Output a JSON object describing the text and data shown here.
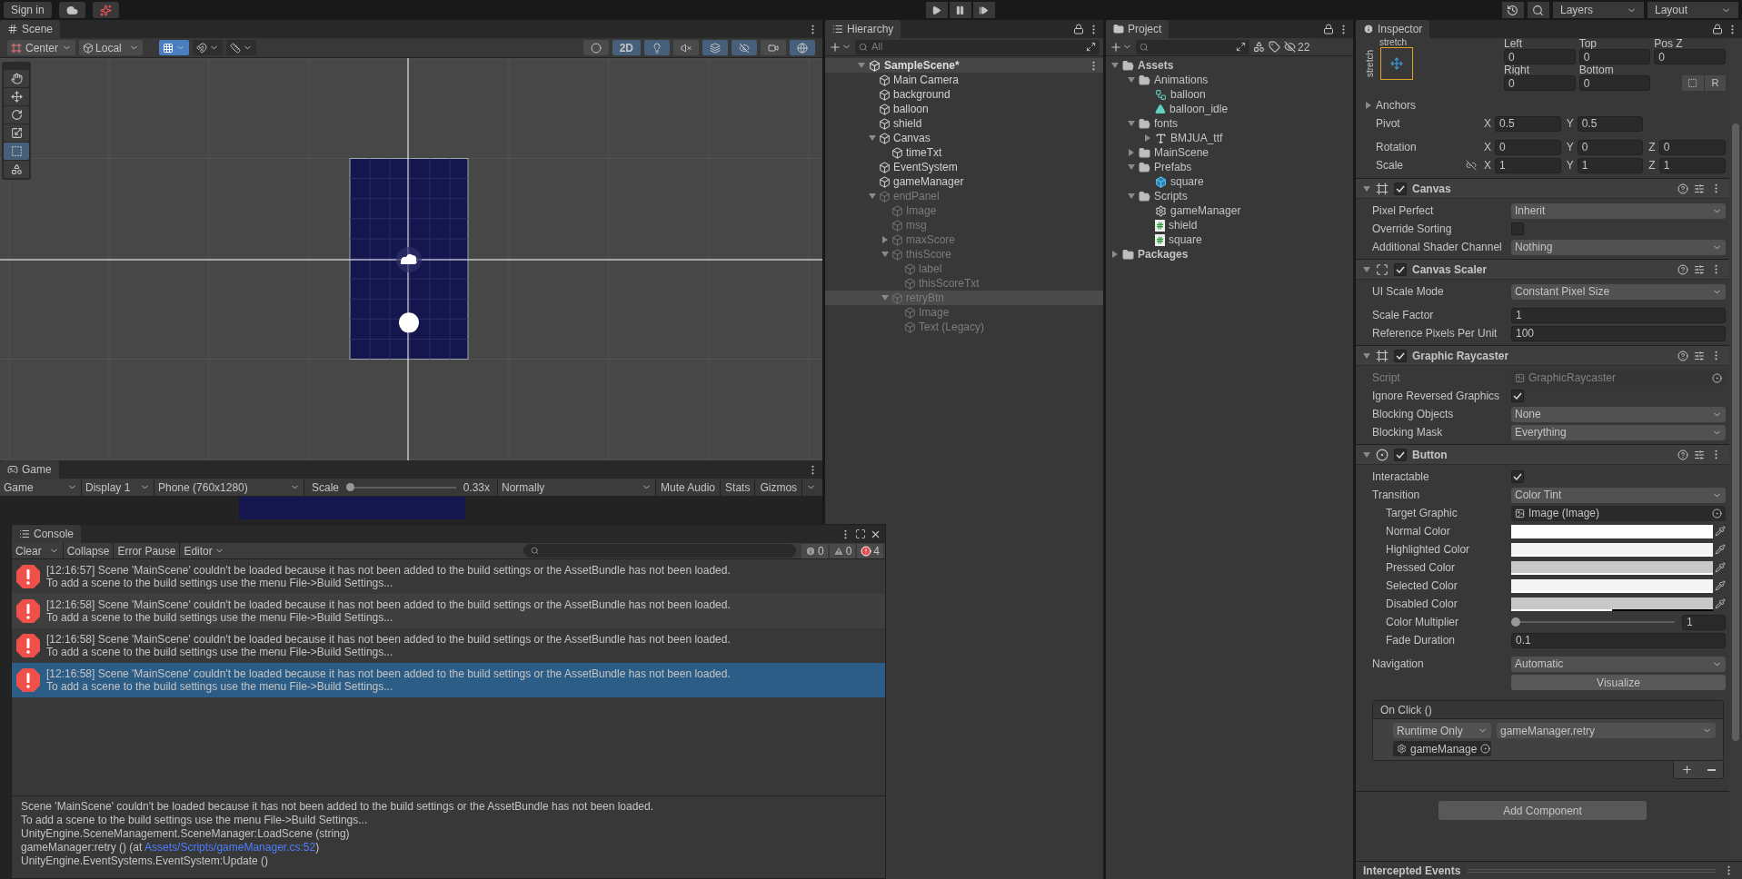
{
  "toolbar": {
    "sign_in": "Sign in",
    "layers": "Layers",
    "layout": "Layout"
  },
  "scene": {
    "tab": "Scene",
    "pivot": "Center",
    "space": "Local",
    "snap_toggles": [
      {
        "kind": "grid",
        "on": true
      },
      {
        "kind": "increment",
        "on": false
      },
      {
        "kind": "ruler",
        "on": false
      }
    ],
    "view_toggles": [
      {
        "kind": "shading",
        "on": false
      },
      {
        "kind": "dimension",
        "label": "2D",
        "on": true
      },
      {
        "kind": "light",
        "on": true
      },
      {
        "kind": "audio",
        "on": false
      },
      {
        "kind": "effects",
        "on": true
      },
      {
        "kind": "hidden",
        "on": true
      },
      {
        "kind": "camera",
        "on": false
      },
      {
        "kind": "gizmos",
        "on": true
      }
    ],
    "tools": [
      {
        "kind": "hand",
        "selected": false
      },
      {
        "kind": "move",
        "selected": false
      },
      {
        "kind": "rotate",
        "selected": false
      },
      {
        "kind": "scale",
        "selected": false
      },
      {
        "kind": "rect",
        "selected": true
      },
      {
        "kind": "transform",
        "selected": false
      }
    ]
  },
  "game": {
    "tab": "Game",
    "view": "Game",
    "display": "Display 1",
    "resolution": "Phone (760x1280)",
    "scale_label": "Scale",
    "scale": {
      "level": 0,
      "reading": "0.33x"
    },
    "play_focus": "Normally",
    "buttons": [
      "Mute Audio",
      "Stats",
      "Gizmos"
    ]
  },
  "hierarchy": {
    "tab": "Hierarchy",
    "placeholder": "All",
    "scene": "SampleScene*",
    "items": [
      {
        "label": "Main Camera",
        "active": true,
        "selected": false
      },
      {
        "label": "background",
        "active": true,
        "selected": false
      },
      {
        "label": "balloon",
        "active": true,
        "selected": false
      },
      {
        "label": "shield",
        "active": true,
        "selected": false
      },
      {
        "label": "Canvas",
        "active": true,
        "selected": false,
        "expanded": true,
        "children": [
          {
            "label": "timeTxt",
            "active": true,
            "selected": false
          }
        ]
      },
      {
        "label": "EventSystem",
        "active": true,
        "selected": false
      },
      {
        "label": "gameManager",
        "active": true,
        "selected": false
      },
      {
        "label": "endPanel",
        "active": false,
        "selected": false,
        "expanded": true,
        "children": [
          {
            "label": "Image",
            "active": false,
            "selected": false
          },
          {
            "label": "msg",
            "active": false,
            "selected": false
          },
          {
            "label": "maxScore",
            "active": false,
            "selected": false,
            "expanded": false
          },
          {
            "label": "thisScore",
            "active": false,
            "selected": false,
            "expanded": true,
            "children": [
              {
                "label": "label",
                "active": false,
                "selected": false
              },
              {
                "label": "thisScoreTxt",
                "active": false,
                "selected": false
              }
            ]
          },
          {
            "label": "retryBtn",
            "active": false,
            "selected": true,
            "expanded": true,
            "children": [
              {
                "label": "Image",
                "active": false,
                "selected": false
              },
              {
                "label": "Text (Legacy)",
                "active": false,
                "selected": false
              }
            ]
          }
        ]
      }
    ]
  },
  "project": {
    "tab": "Project",
    "hidden_count": "22",
    "items": [
      {
        "label": "Assets",
        "kind": "folder",
        "expanded": true,
        "bold": true,
        "children": [
          {
            "label": "Animations",
            "kind": "folder",
            "expanded": true,
            "children": [
              {
                "label": "balloon",
                "kind": "controller"
              },
              {
                "label": "balloon_idle",
                "kind": "clip"
              }
            ]
          },
          {
            "label": "fonts",
            "kind": "folder",
            "expanded": true,
            "children": [
              {
                "label": "BMJUA_ttf",
                "kind": "font",
                "expanded": false
              }
            ]
          },
          {
            "label": "MainScene",
            "kind": "folder",
            "expanded": false
          },
          {
            "label": "Prefabs",
            "kind": "folder",
            "expanded": true,
            "children": [
              {
                "label": "square",
                "kind": "prefab"
              }
            ]
          },
          {
            "label": "Scripts",
            "kind": "folder",
            "expanded": true,
            "children": [
              {
                "label": "gameManager",
                "kind": "gear"
              },
              {
                "label": "shield",
                "kind": "script"
              },
              {
                "label": "square",
                "kind": "script"
              }
            ]
          }
        ]
      },
      {
        "label": "Packages",
        "kind": "folder",
        "expanded": false,
        "bold": true
      }
    ]
  },
  "inspector": {
    "tab": "Inspector",
    "rect": {
      "anchor_h": "stretch",
      "anchor_v": "stretch",
      "fields": [
        {
          "label": "Left",
          "value": "0"
        },
        {
          "label": "Top",
          "value": "0"
        },
        {
          "label": "Pos Z",
          "value": "0"
        },
        {
          "label": "Right",
          "value": "0"
        },
        {
          "label": "Bottom",
          "value": "0"
        }
      ],
      "reset": "R",
      "anchors": {
        "label": "Anchors",
        "expanded": false
      },
      "vectors": [
        {
          "label": "Pivot",
          "axes": [
            {
              "axis": "X",
              "value": "0.5"
            },
            {
              "axis": "Y",
              "value": "0.5"
            }
          ]
        },
        {
          "label": "Rotation",
          "axes": [
            {
              "axis": "X",
              "value": "0"
            },
            {
              "axis": "Y",
              "value": "0"
            },
            {
              "axis": "Z",
              "value": "0"
            }
          ]
        },
        {
          "label": "Scale",
          "constrained": false,
          "axes": [
            {
              "axis": "X",
              "value": "1"
            },
            {
              "axis": "Y",
              "value": "1"
            },
            {
              "axis": "Z",
              "value": "1"
            }
          ]
        }
      ]
    },
    "components": [
      {
        "title": "Canvas",
        "kind": "canvas",
        "enabled": true,
        "expanded": true,
        "rows": [
          {
            "kind": "dropdown",
            "label": "Pixel Perfect",
            "value": "Inherit"
          },
          {
            "kind": "checkbox",
            "label": "Override Sorting",
            "checked": false
          },
          {
            "kind": "dropdown",
            "label": "Additional Shader Channel",
            "value": "Nothing"
          }
        ]
      },
      {
        "title": "Canvas Scaler",
        "kind": "scaler",
        "enabled": true,
        "expanded": true,
        "rows": [
          {
            "kind": "dropdown",
            "label": "UI Scale Mode",
            "value": "Constant Pixel Size"
          },
          {
            "kind": "field",
            "label": "Scale Factor",
            "value": "1",
            "spaced": true
          },
          {
            "kind": "field",
            "label": "Reference Pixels Per Unit",
            "value": "100"
          }
        ]
      },
      {
        "title": "Graphic Raycaster",
        "kind": "raycaster",
        "enabled": true,
        "expanded": true,
        "rows": [
          {
            "kind": "object",
            "label": "Script",
            "value": "GraphicRaycaster",
            "disabled": true
          },
          {
            "kind": "checkbox",
            "label": "Ignore Reversed Graphics",
            "checked": true
          },
          {
            "kind": "dropdown",
            "label": "Blocking Objects",
            "value": "None"
          },
          {
            "kind": "dropdown",
            "label": "Blocking Mask",
            "value": "Everything"
          }
        ]
      },
      {
        "title": "Button",
        "kind": "button",
        "enabled": true,
        "expanded": true,
        "rows": [
          {
            "kind": "checkbox",
            "label": "Interactable",
            "checked": true
          },
          {
            "kind": "dropdown",
            "label": "Transition",
            "value": "Color Tint",
            "children": [
              {
                "kind": "object",
                "label": "Target Graphic",
                "value": "Image (Image)"
              },
              {
                "kind": "color",
                "label": "Normal Color",
                "color": "#ffffff",
                "level": 1
              },
              {
                "kind": "color",
                "label": "Highlighted Color",
                "color": "#f5f5f5",
                "level": 1
              },
              {
                "kind": "color",
                "label": "Pressed Color",
                "color": "#c8c8c8",
                "level": 1
              },
              {
                "kind": "color",
                "label": "Selected Color",
                "color": "#f5f5f5",
                "level": 1
              },
              {
                "kind": "color",
                "label": "Disabled Color",
                "color": "#c8c8c8",
                "level": 0.5
              },
              {
                "kind": "slider",
                "label": "Color Multiplier",
                "level": 0,
                "value": "1"
              },
              {
                "kind": "field",
                "label": "Fade Duration",
                "value": "0.1"
              }
            ]
          },
          {
            "kind": "dropdown",
            "label": "Navigation",
            "value": "Automatic",
            "spaced": true
          },
          {
            "kind": "button",
            "value": "Visualize"
          }
        ],
        "event": {
          "title": "On Click ()",
          "mode": "Runtime Only",
          "function": "gameManager.retry",
          "target": "gameManage"
        }
      }
    ],
    "add_component": "Add Component",
    "footer": "Intercepted Events"
  },
  "console": {
    "tab": "Console",
    "clear": "Clear",
    "buttons": [
      "Collapse",
      "Error Pause"
    ],
    "editor": "Editor",
    "counts": [
      {
        "kind": "info",
        "value": "0"
      },
      {
        "kind": "warning",
        "value": "0"
      },
      {
        "kind": "error",
        "value": "4"
      }
    ],
    "entries": [
      {
        "line1": "[12:16:57] Scene 'MainScene' couldn't be loaded because it has not been added to the build settings or the AssetBundle has not been loaded.",
        "line2": "To add a scene to the build settings use the menu File->Build Settings...",
        "selected": false
      },
      {
        "line1": "[12:16:58] Scene 'MainScene' couldn't be loaded because it has not been added to the build settings or the AssetBundle has not been loaded.",
        "line2": "To add a scene to the build settings use the menu File->Build Settings...",
        "selected": false
      },
      {
        "line1": "[12:16:58] Scene 'MainScene' couldn't be loaded because it has not been added to the build settings or the AssetBundle has not been loaded.",
        "line2": "To add a scene to the build settings use the menu File->Build Settings...",
        "selected": false
      },
      {
        "line1": "[12:16:58] Scene 'MainScene' couldn't be loaded because it has not been added to the build settings or the AssetBundle has not been loaded.",
        "line2": "To add a scene to the build settings use the menu File->Build Settings...",
        "selected": true
      }
    ],
    "detail": [
      {
        "text": "Scene 'MainScene' couldn't be loaded because it has not been added to the build settings or the AssetBundle has not been loaded."
      },
      {
        "text": "To add a scene to the build settings use the menu File->Build Settings..."
      },
      {
        "text": "UnityEngine.SceneManagement.SceneManager:LoadScene (string)"
      },
      {
        "text": "gameManager:retry () (at ",
        "link": "Assets/Scripts/gameManager.cs:52",
        "after": ")"
      },
      {
        "text": "UnityEngine.EventSystems.EventSystem:Update ()"
      }
    ]
  }
}
